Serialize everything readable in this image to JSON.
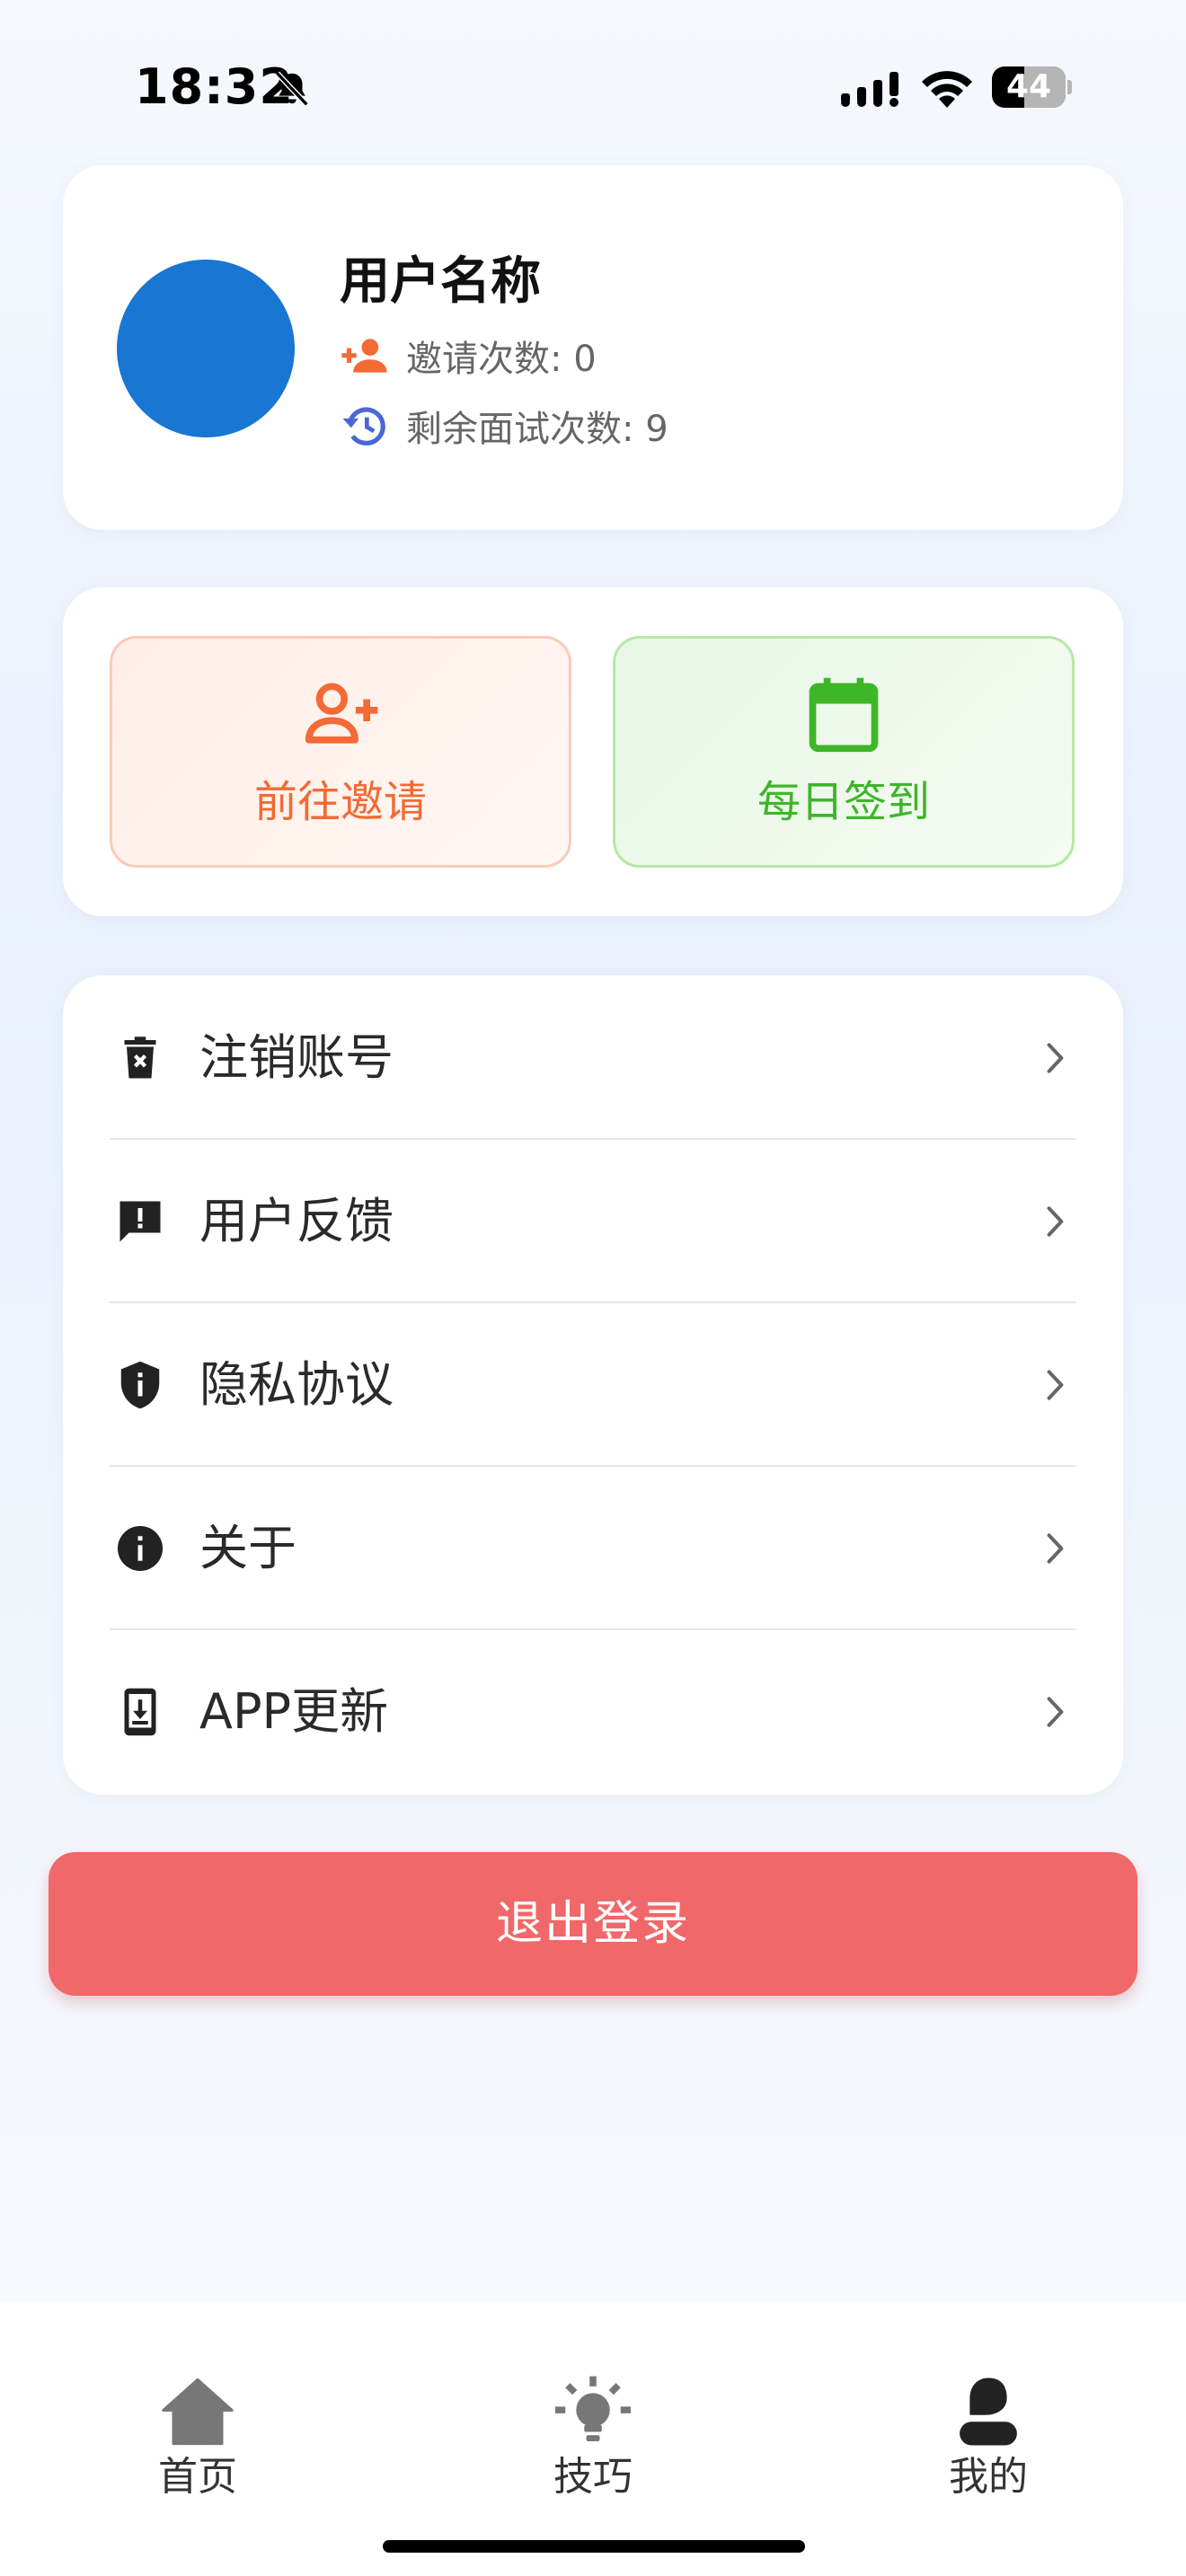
{
  "status_bar": {
    "time": "18:32",
    "battery": "44"
  },
  "profile": {
    "name": "用户名称",
    "invite_count": "邀请次数: 0",
    "remaining_interviews": "剩余面试次数: 9",
    "avatar_color": "#1976d2"
  },
  "actions": {
    "invite_label": "前往邀请",
    "checkin_label": "每日签到",
    "invite_color": "#f26a35",
    "checkin_color": "#3fb52a"
  },
  "menu": {
    "items": [
      {
        "label": "注销账号",
        "icon": "delete-account-icon"
      },
      {
        "label": "用户反馈",
        "icon": "feedback-icon"
      },
      {
        "label": "隐私协议",
        "icon": "privacy-shield-icon"
      },
      {
        "label": "关于",
        "icon": "info-icon"
      },
      {
        "label": "APP更新",
        "icon": "app-update-icon"
      }
    ]
  },
  "logout": {
    "label": "退出登录",
    "color": "#f0686a"
  },
  "bottom_nav": {
    "items": [
      {
        "label": "首页",
        "icon": "home-icon",
        "active": false
      },
      {
        "label": "技巧",
        "icon": "lightbulb-icon",
        "active": false
      },
      {
        "label": "我的",
        "icon": "person-icon",
        "active": true
      }
    ]
  }
}
